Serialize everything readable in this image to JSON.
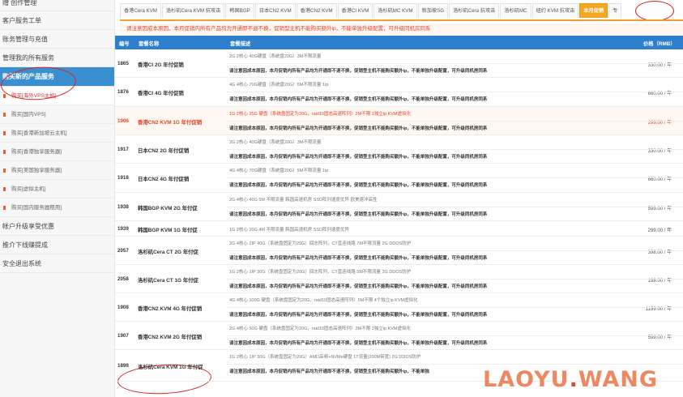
{
  "sidebar": {
    "items": [
      {
        "label": "赠    创作管理"
      },
      {
        "label": "客户服务工单"
      },
      {
        "label": "账务管理与充值"
      },
      {
        "label": "管理我的所有服务"
      },
      {
        "label": "购买新的产品服务"
      }
    ],
    "sub_items": [
      {
        "label": "购买[海外VPS主机]"
      },
      {
        "label": "购买[国内VPS]"
      },
      {
        "label": "购买[香港新加坡云主机]"
      },
      {
        "label": "购买[香港独享服务器]"
      },
      {
        "label": "购买[美国独享服务器]"
      },
      {
        "label": "购买[虚拟主机]"
      },
      {
        "label": "购买[国内服务器租用]"
      }
    ],
    "bottom_items": [
      {
        "label": "帐户升级享受优惠"
      },
      {
        "label": "推介下线赚提成"
      },
      {
        "label": "安全退出系统"
      }
    ]
  },
  "tabs": [
    {
      "label": "香港Cera KVM"
    },
    {
      "label": "洛杉矶Cera KVM 抗攻击"
    },
    {
      "label": "韩国BGP"
    },
    {
      "label": "日本CN2 KVM"
    },
    {
      "label": "香港CN2 KVM"
    },
    {
      "label": "香港CI KVM"
    },
    {
      "label": "洛杉矶MC KVM"
    },
    {
      "label": "新加坡SG"
    },
    {
      "label": "洛杉矶Cera 抗攻击"
    },
    {
      "label": "洛杉矶MC"
    },
    {
      "label": "纽约 KVM 抗攻击"
    },
    {
      "label": "本月促销"
    },
    {
      "label": "专"
    }
  ],
  "notice": "请注意因成本原因，本月促销内所有产品均为开通即不退不换，促销型主机不能购买额外ip，不能单独升级配置，可升级同机房同系",
  "table": {
    "headers": {
      "id": "编号",
      "name": "套餐名称",
      "desc": "套餐描述",
      "price": "价格（RMB）"
    },
    "rows": [
      {
        "id": "1865",
        "name": "香港CI 2G 年付促销",
        "desc1": "2G 2核心 40G硬盘（系统盘20G）3M不限流量",
        "desc2": "请注意因成本原因，本月促销内所有产品均为开通即不退不换，促销型主机不能购买额外ip，不能单独升级配置，可升级同机房同系",
        "price": "330.00 / 年"
      },
      {
        "id": "1876",
        "name": "香港CI 4G 年付促销",
        "desc1": "4G 4核心 70G硬盘（系统盘20G）5M不限流量 1ip",
        "desc2": "请注意因成本原因，本月促销内所有产品均为开通即不退不换，促销型主机不能购买额外ip，不能单独升级配置，可升级同机房同系",
        "price": "660.00 / 年"
      },
      {
        "id": "1906",
        "name": "香港CN2 KVM 1G 年付促销",
        "desc1": "1G 2核心 25G 硬盘（系统盘固定为20G，raid10固态高速阵列）2M不限 1独立ip KVM虚拟化",
        "desc2": "请注意因成本原因，本月促销内所有产品均为开通即不退不换，促销型主机不能购买额外ip，不能单独升级配置，可升级同机房同系",
        "price": "299.00 / 年"
      },
      {
        "id": "1917",
        "name": "日本CN2 2G 年付促销",
        "desc1": "2G 2核心 40G硬盘（系统盘20G）3M不限流量",
        "desc2": "请注意因成本原因，本月促销内所有产品均为开通即不退不换，促销型主机不能购买额外ip，不能单独升级配置，可升级同机房同系",
        "price": "330.00 / 年"
      },
      {
        "id": "1918",
        "name": "日本CN2 4G 年付促销",
        "desc1": "4G 4核心 70G硬盘（系统盘20G）5M不限流量 1ip",
        "desc2": "请注意因成本原因，本月促销内所有产品均为开通即不退不换，促销型主机不能购买额外ip，不能单独升级配置，可升级同机房同系",
        "price": "660.00 / 年"
      },
      {
        "id": "1938",
        "name": "韩国BGP KVM 2G 年付促",
        "desc1": "2G 4核心 40G 5M 不限流量 韩国高速机房 SSD阵列速度优异 欧美速冲高性",
        "desc2": "请注意因成本原因，本月促销内所有产品均为开通即不退不换，促销型主机不能购买额外ip，不能单独升级配置，可升级同机房同系",
        "price": "599.00 / 年"
      },
      {
        "id": "1939",
        "name": "韩国BGP KVM 1G 年付促",
        "desc1": "1G 2核心 20G 4M 不限流量 韩国高速机房 SSD阵列速度优异",
        "desc2": "",
        "price": "299.00 / 年"
      },
      {
        "id": "2057",
        "name": "洛杉矶Cera CT 2G 年付促",
        "desc1": "2G 4核心 2IP 40G（系统盘固定为20G）回志阵列，CT直连线路 7M不限流量 2G DDOS防护",
        "desc2": "请注意因成本原因，本月促销内所有产品均为开通即不退不换，促销型主机不能购买额外ip，不能单独升级配置，可升级同机房同系",
        "price": "398.00 / 年"
      },
      {
        "id": "2058",
        "name": "洛杉矶Cera CT 1G 年付促",
        "desc1": "1G 2核心 1IP 30G（系统盘固定为20G）回志阵列，CT直连线路 5M不限流量 2G DDOS防护",
        "desc2": "请注意因成本原因，本月促销内所有产品均为开通即不退不换，促销型主机不能购买额外ip，不能单独升级配置，可升级同机房同系",
        "price": "198.00 / 年"
      },
      {
        "id": "1908",
        "name": "香港CN2 KVM 4G 年付促销",
        "desc1": "4G 4核心 100G 硬盘（系统盘固定为20G，raid10固态高速阵列）5M不限 4个独立ip KVM虚拟化",
        "desc2": "请注意因成本原因，本月促销内所有产品均为开通即不退不换，促销型主机不能购买额外ip，不能单独升级配置，可升级同机房同系",
        "price": "1199.00 / 年"
      },
      {
        "id": "1907",
        "name": "香港CN2 KVM 2G 年付促销",
        "desc1": "2G 4核心 50G 硬盘（系统盘固定为20G，raid10固态高速阵列）3M不限 2独立ip KVM虚拟化",
        "desc2": "请注意因成本原因，本月促销内所有产品均为开通即不退不换，促销型主机不能购买额外ip，不能单独升级配置，可升级同机房同系",
        "price": "599.00 / 年"
      },
      {
        "id": "1899",
        "name": "洛杉矶Cera KVM 1G 年付促",
        "desc1": "1G 2核心 1IP 30G（系统盘固定为20G）AMD高频+NVMe硬盘 1T流量(200M带宽) 2G DDOS防护",
        "desc2": "请注意因成本原因，本月促销内所有产品均为开通即不退不换，促销型主机不能购买额外ip，不能单独",
        "price": ""
      }
    ]
  },
  "watermark": {
    "part1": "LAOYU",
    "dot": ".",
    "part2": "WANG"
  },
  "colors": {
    "accent": "#3a8fd1",
    "promo_tab": "#f5a623",
    "notice_red": "#e2452a",
    "annotation_red": "#dd2222",
    "watermark": "#ea7447"
  }
}
